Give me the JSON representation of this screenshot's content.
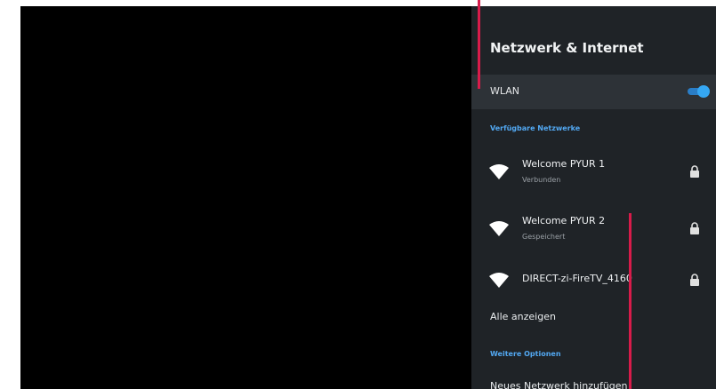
{
  "panel": {
    "title": "Netzwerk & Internet",
    "wlan": {
      "label": "WLAN",
      "enabled": true
    },
    "available_header": "Verfügbare Netzwerke",
    "networks": [
      {
        "name": "Welcome PYUR 1",
        "status": "Verbunden",
        "locked": true
      },
      {
        "name": "Welcome PYUR 2",
        "status": "Gespeichert",
        "locked": true
      },
      {
        "name": "DIRECT-zi-FireTV_4160",
        "status": "",
        "locked": true
      }
    ],
    "show_all": "Alle anzeigen",
    "more_options_header": "Weitere Optionen",
    "add_network": "Neues Netzwerk hinzufügen"
  },
  "colors": {
    "panel_bg": "#1f2327",
    "wlan_row_bg": "#2d3237",
    "accent": "#35a7f3",
    "section_header": "#52a8f2",
    "cursor_marker": "#d81b4a"
  }
}
